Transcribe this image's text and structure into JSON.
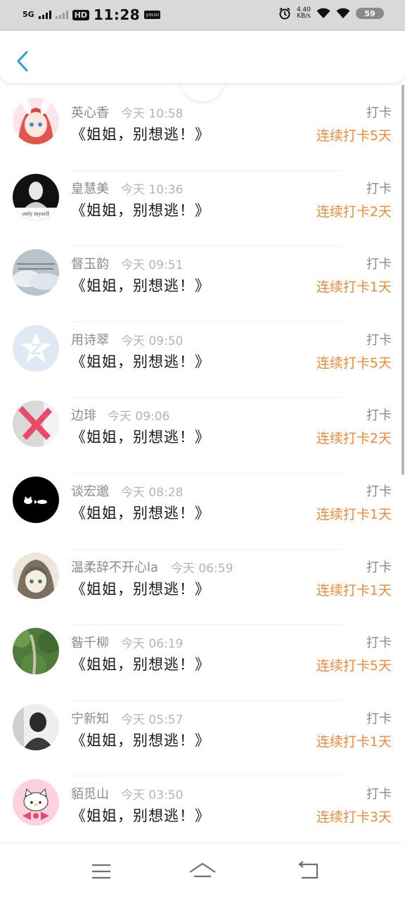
{
  "status_bar": {
    "network": "5G",
    "hd": "HD",
    "time": "11:28",
    "badge": "youxi",
    "speed_value": "4.40",
    "speed_unit": "KB/s",
    "battery": "59"
  },
  "header": {
    "back_icon": "chevron-left-icon"
  },
  "feed": [
    {
      "name": "英心香",
      "time": "今天 10:58",
      "title": "《姐姐，别想逃！》",
      "action": "打卡",
      "streak": "连续打卡5天"
    },
    {
      "name": "皇慧美",
      "time": "今天 10:36",
      "title": "《姐姐，别想逃！》",
      "action": "打卡",
      "streak": "连续打卡2天",
      "avatar_text": "only myself"
    },
    {
      "name": "督玉韵",
      "time": "今天 09:51",
      "title": "《姐姐，别想逃！》",
      "action": "打卡",
      "streak": "连续打卡1天"
    },
    {
      "name": "用诗翠",
      "time": "今天 09:50",
      "title": "《姐姐，别想逃！》",
      "action": "打卡",
      "streak": "连续打卡5天"
    },
    {
      "name": "边琲",
      "time": "今天 09:06",
      "title": "《姐姐，别想逃！》",
      "action": "打卡",
      "streak": "连续打卡2天"
    },
    {
      "name": "谈宏邈",
      "time": "今天 08:28",
      "title": "《姐姐，别想逃！》",
      "action": "打卡",
      "streak": "连续打卡1天"
    },
    {
      "name": "温柔辞不开心la",
      "time": "今天 06:59",
      "title": "《姐姐，别想逃！》",
      "action": "打卡",
      "streak": "连续打卡1天"
    },
    {
      "name": "昝千柳",
      "time": "今天 06:19",
      "title": "《姐姐，别想逃！》",
      "action": "打卡",
      "streak": "连续打卡5天"
    },
    {
      "name": "宁新知",
      "time": "今天 05:57",
      "title": "《姐姐，别想逃！》",
      "action": "打卡",
      "streak": "连续打卡1天"
    },
    {
      "name": "貊觅山",
      "time": "今天 03:50",
      "title": "《姐姐，别想逃！》",
      "action": "打卡",
      "streak": "连续打卡3天"
    }
  ],
  "nav": {
    "menu_icon": "menu-icon",
    "home_icon": "home-icon",
    "back_icon": "back-icon"
  },
  "colors": {
    "accent": "#2f9be0",
    "streak": "#ee8a3a"
  }
}
